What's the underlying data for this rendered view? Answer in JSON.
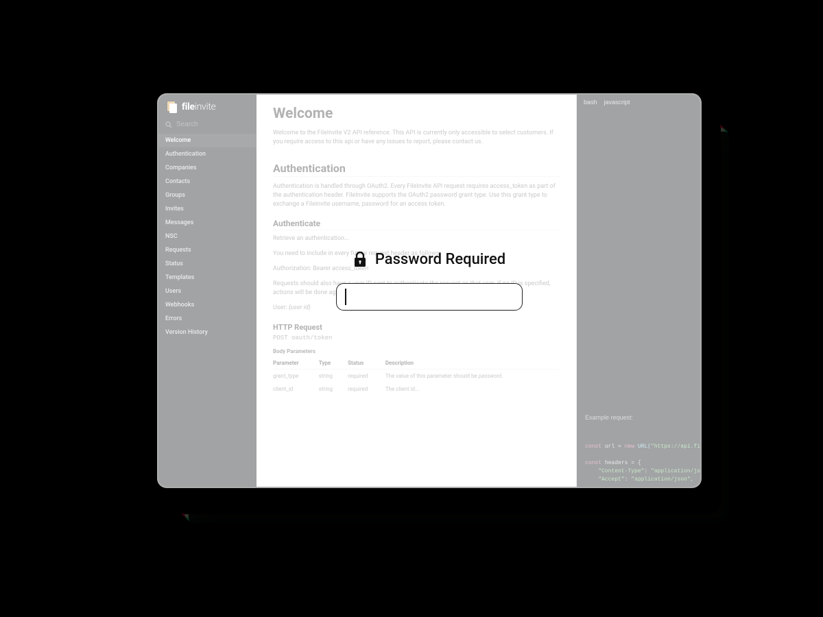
{
  "logo": {
    "brand_bold": "file",
    "brand_light": "invite"
  },
  "search": {
    "placeholder": "Search"
  },
  "nav": [
    "Welcome",
    "Authentication",
    "Companies",
    "Contacts",
    "Groups",
    "Invites",
    "Messages",
    "NSC",
    "Requests",
    "Status",
    "Templates",
    "Users",
    "Webhooks",
    "Errors",
    "Version History"
  ],
  "content": {
    "welcome_heading": "Welcome",
    "welcome_body": "Welcome to the FileInvite V2 API reference. This API is currently only accessible to select customers. If you require access to this api or have any issues to report, please contact us.",
    "auth_heading": "Authentication",
    "auth_body": "Authentication is handled through OAuth2. Every FileInvite API request requires access_token as part of the authentication header. FileInvite supports the OAuth2 password grant type. Use this grant type to exchange a Fileinvite username, password for an access token.",
    "authenticate_heading": "Authenticate",
    "retrieve_line": "Retrieve an authentication...",
    "include_line": "You need to include in every future request header as follows:",
    "bearer_prefix": "Authorization: Bearer ",
    "bearer_token": "access_token",
    "requests_line": "Requests should also have a user ID sent to authenticate the request as that user. If no ID is specified, actions will be done against the master user.",
    "user_prefix": "User: ",
    "user_value": "{user id}",
    "http_request_heading": "HTTP Request",
    "http_line": "POST oauth/token",
    "body_params_label": "Body Parameters",
    "table_headers": [
      "Parameter",
      "Type",
      "Status",
      "Description"
    ],
    "table_rows": [
      {
        "param": "grant_type",
        "type": "string",
        "status": "required",
        "desc_prefix": "The value of this parameter should be ",
        "desc_em": "password",
        "desc_suffix": "."
      },
      {
        "param": "client_id",
        "type": "string",
        "status": "required",
        "desc_prefix": "The client id...",
        "desc_em": "",
        "desc_suffix": ""
      }
    ]
  },
  "code_panel": {
    "langs": [
      "bash",
      "javascript"
    ],
    "example_label": "Example request:",
    "tokens": {
      "l1_kw1": "const",
      "l1_var": " url = ",
      "l1_kw2": "new",
      "l1_fn": " URL(",
      "l1_str": "\"https://api.file",
      "l2_kw": "const",
      "l2_rest": " headers = {",
      "l3_key": "    \"Content-Type\"",
      "l3_sep": ": ",
      "l3_val": "\"application/json\"",
      "l4_key": "    \"Accept\"",
      "l4_sep": ": ",
      "l4_val": "\"application/json\","
    }
  },
  "overlay": {
    "title": "Password Required"
  }
}
